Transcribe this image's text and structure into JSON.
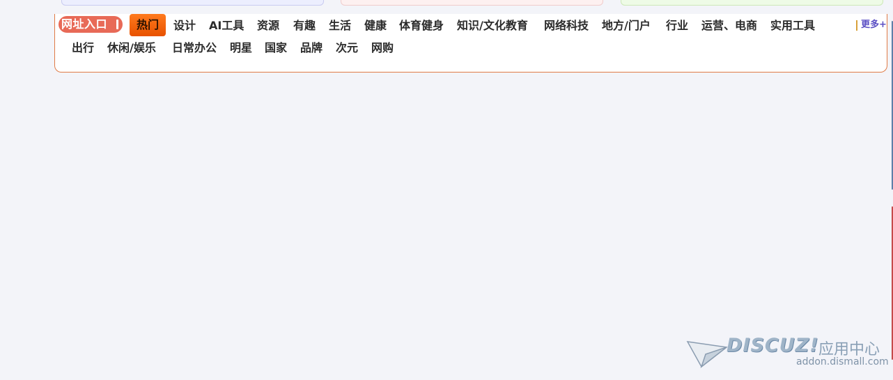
{
  "entry_label": "网址入口",
  "active_tab": "热门",
  "categories_row1": [
    "设计",
    "AI工具",
    "资源",
    "有趣",
    "生活",
    "健康",
    "体育健身",
    "知识/文化教育",
    "网络科技",
    "地方/门户",
    "行业",
    "运营、电商",
    "实用工具"
  ],
  "categories_row2": [
    "出行",
    "休闲/娱乐",
    "日常办公",
    "明星",
    "国家",
    "品牌",
    "次元",
    "网购"
  ],
  "more_label": "更多+",
  "watermark": {
    "brand": "DISCUZ!",
    "subtitle": "应用中心",
    "url": "addon.dismall.com"
  },
  "colors": {
    "accent": "#e85200",
    "badge": "#e86a57",
    "border": "#e07a45",
    "more": "#5b4fc4",
    "background": "#f3f4f9"
  }
}
